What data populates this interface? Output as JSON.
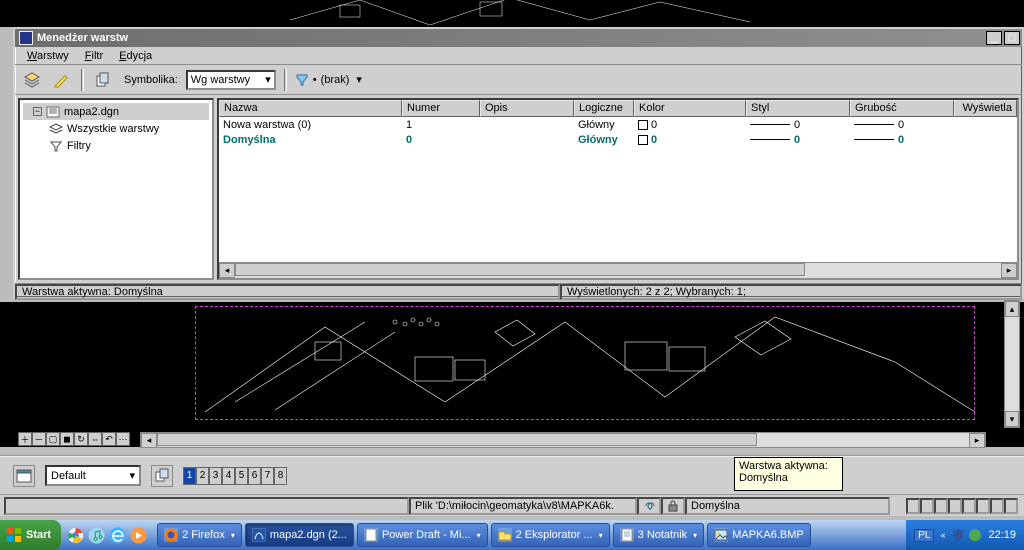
{
  "lm": {
    "title": "Menedżer warstw",
    "menu": [
      "Warstwy",
      "Filtr",
      "Edycja"
    ],
    "symbolika_label": "Symbolika:",
    "symbolika_value": "Wg warstwy",
    "brak_label": "(brak)",
    "tree": {
      "root": "mapa2.dgn",
      "item1": "Wszystkie warstwy",
      "item2": "Filtry"
    },
    "headers": [
      "Nazwa",
      "Numer",
      "Opis",
      "Logiczne",
      "Kolor",
      "Styl",
      "Grubość",
      "Wyświetla"
    ],
    "rows": [
      {
        "name": "Nowa warstwa (0)",
        "num": "1",
        "desc": "",
        "log": "Główny",
        "kolor": "0",
        "styl": "0",
        "grub": "0"
      },
      {
        "name": "Domyślna",
        "num": "0",
        "desc": "",
        "log": "Główny",
        "kolor": "0",
        "styl": "0",
        "grub": "0"
      }
    ],
    "status_left": "Warstwa aktywna: Domyślna",
    "status_right": "Wyświetlonych: 2 z 2; Wybranych: 1;"
  },
  "footer1": {
    "combo": "Default",
    "views": [
      "1",
      "2",
      "3",
      "4",
      "5",
      "6",
      "7",
      "8"
    ]
  },
  "tooltip": {
    "l1": "Warstwa aktywna:",
    "l2": "Domyślna"
  },
  "footer2": {
    "path": "Plik 'D:\\miłocin\\geomatyka\\v8\\MAPKA6k.",
    "layer": "Domyślna"
  },
  "taskbar": {
    "start": "Start",
    "tasks": [
      {
        "label": "2 Firefox"
      },
      {
        "label": "mapa2.dgn (2..."
      },
      {
        "label": "Power Draft - Mi..."
      },
      {
        "label": "2 Eksplorator ..."
      },
      {
        "label": "3 Notatnik"
      },
      {
        "label": "MAPKA6.BMP"
      }
    ],
    "lang": "PL",
    "clock": "22:19"
  }
}
